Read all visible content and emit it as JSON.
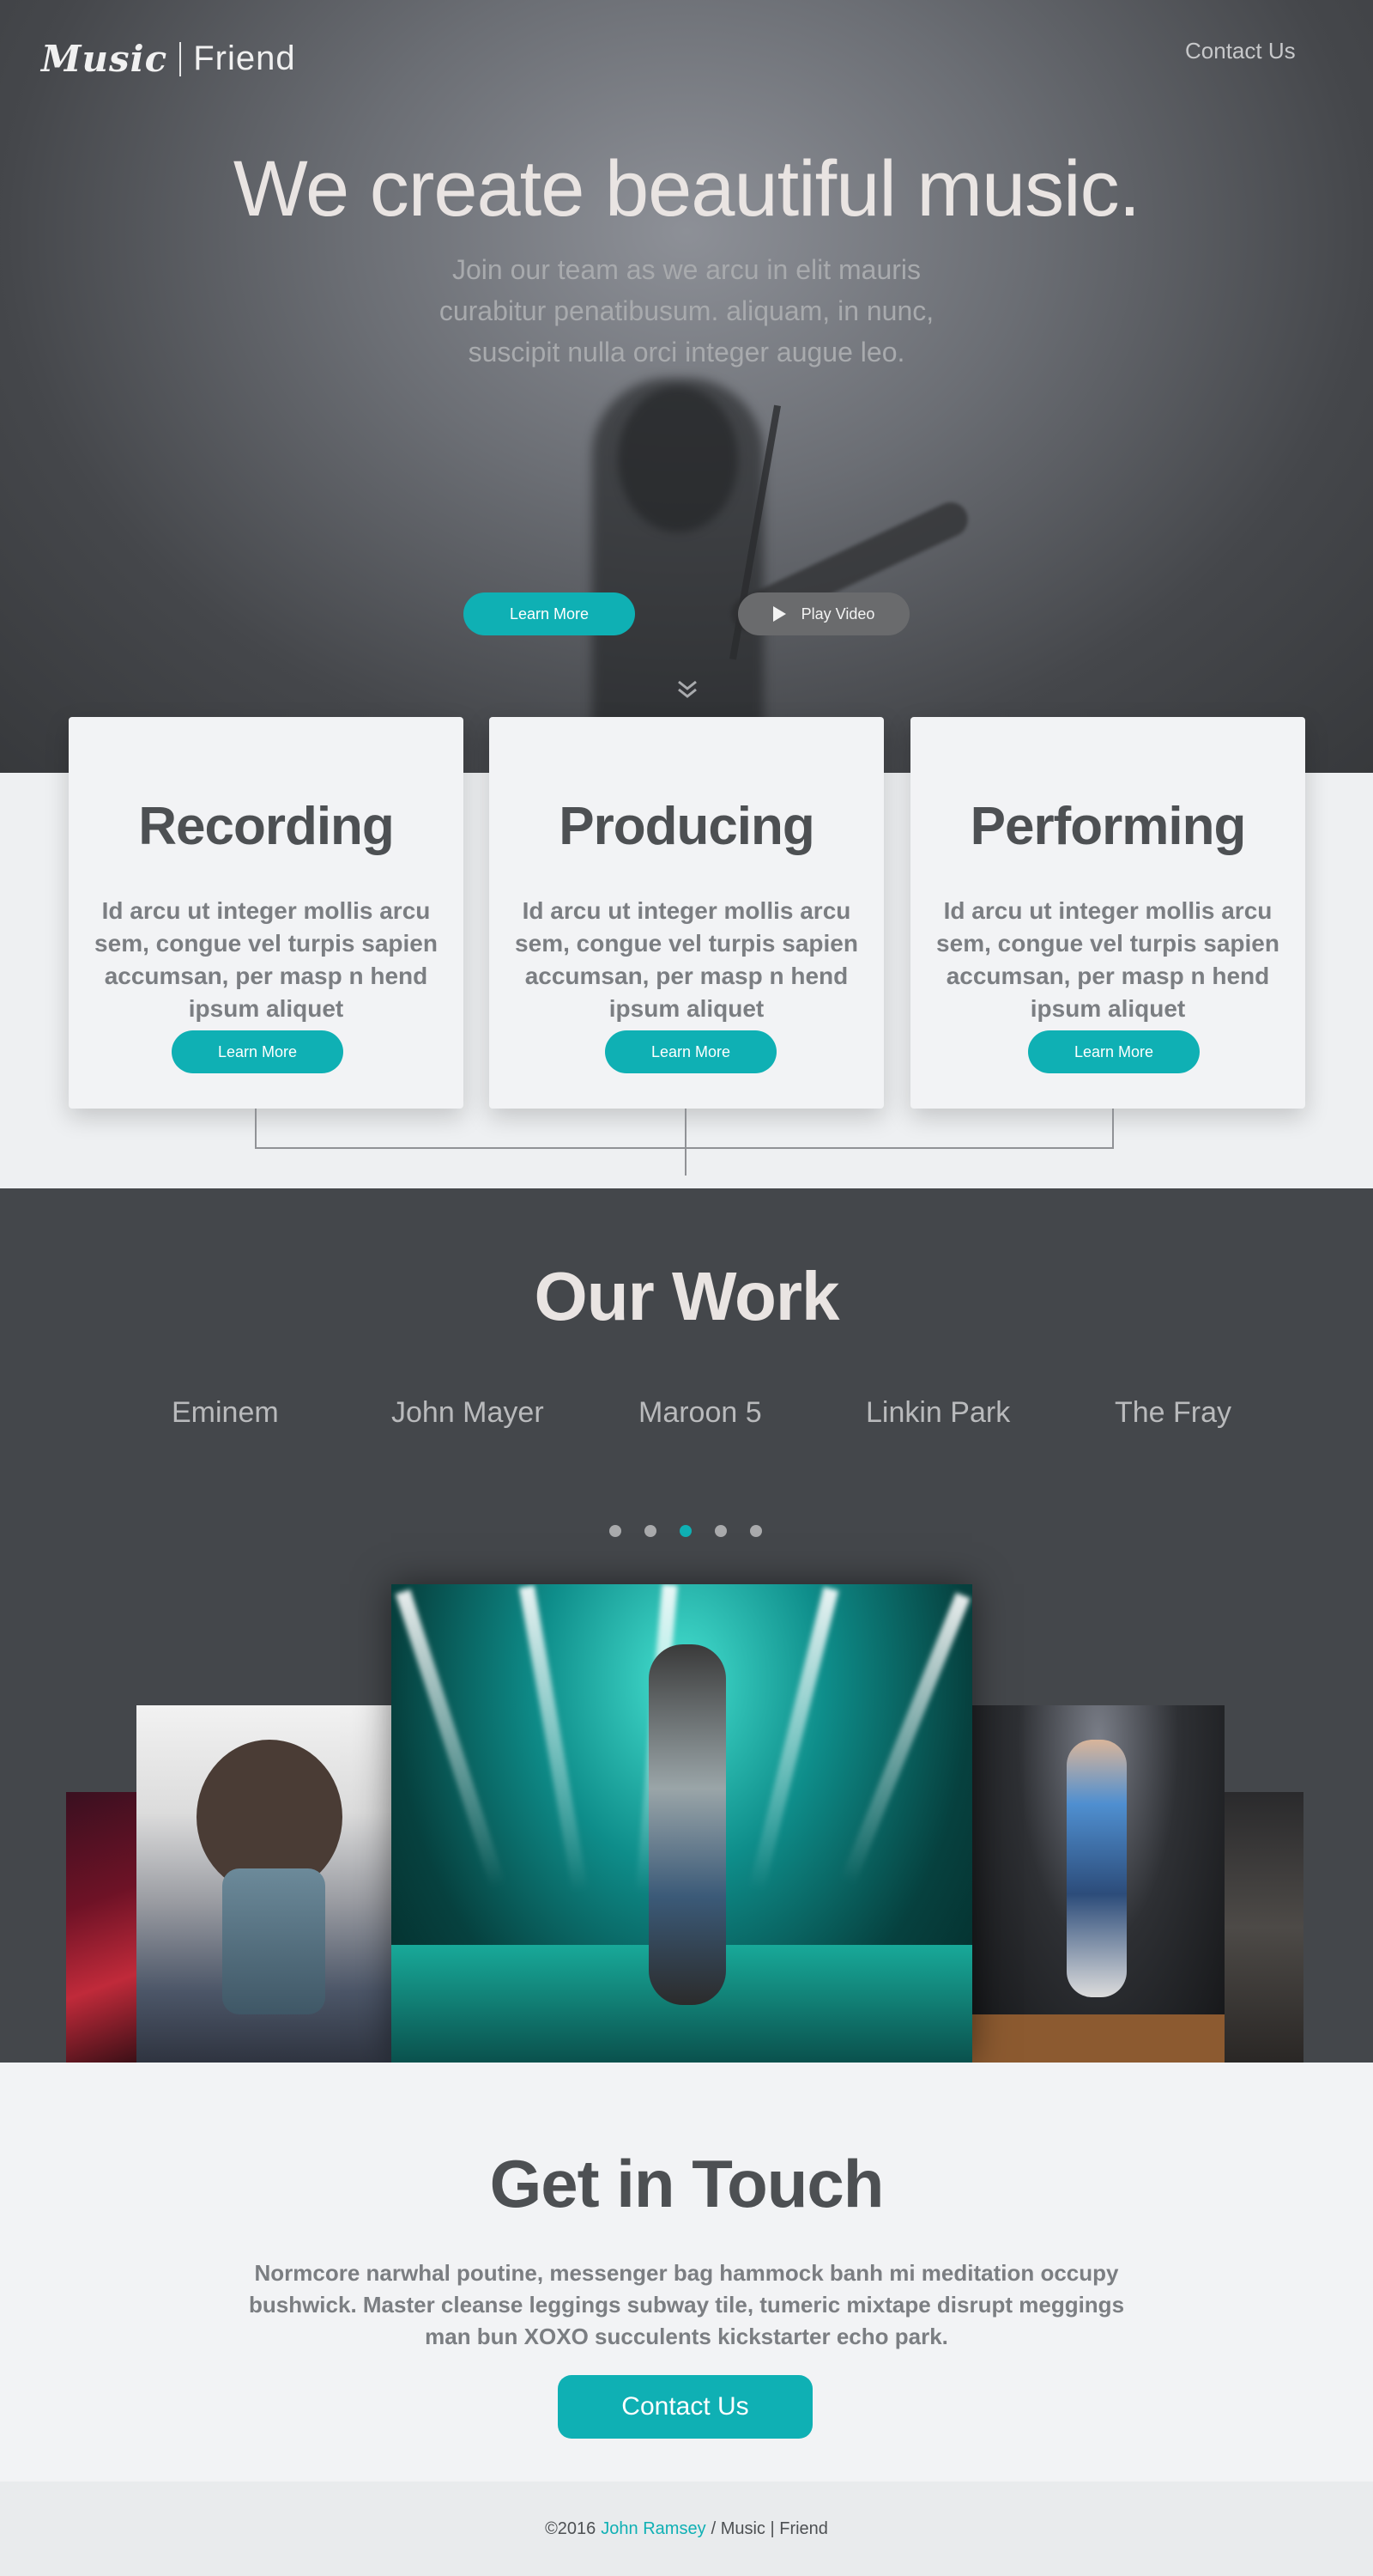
{
  "brand": {
    "music": "Music",
    "friend": "Friend"
  },
  "nav": {
    "contact": "Contact Us"
  },
  "hero": {
    "title": "We create beautiful music.",
    "subtitle": "Join our team as we arcu in elit mauris curabitur penatibusum. aliquam, in nunc, suscipit nulla orci integer augue leo.",
    "learn_more": "Learn More",
    "play_video": "Play Video"
  },
  "services": [
    {
      "title": "Recording",
      "text": "Id arcu ut integer mollis arcu sem, congue vel turpis sapien accumsan, per masp n hend ipsum aliquet",
      "button": "Learn More"
    },
    {
      "title": "Producing",
      "text": "Id arcu ut integer mollis arcu sem, congue vel turpis sapien accumsan, per masp n hend ipsum aliquet",
      "button": "Learn More"
    },
    {
      "title": "Performing",
      "text": "Id arcu ut integer mollis arcu sem, congue vel turpis sapien accumsan, per masp n hend ipsum aliquet",
      "button": "Learn More"
    }
  ],
  "work": {
    "title": "Our Work",
    "artists": [
      "Eminem",
      "John Mayer",
      "Maroon 5",
      "Linkin Park",
      "The Fray"
    ],
    "active_slide": 3,
    "slide_count": 5
  },
  "contact": {
    "title": "Get in Touch",
    "text": "Normcore narwhal poutine, messenger bag hammock banh mi meditation occupy bushwick. Master cleanse leggings subway tile, tumeric mixtape disrupt meggings man bun XOXO succulents kickstarter echo park.",
    "button": "Contact Us"
  },
  "footer": {
    "copyright": "©2016",
    "author": "John Ramsey",
    "suffix": "/ Music | Friend"
  },
  "colors": {
    "accent": "#0fb0b4",
    "dark": "#44474b",
    "heading": "#4d5053"
  }
}
